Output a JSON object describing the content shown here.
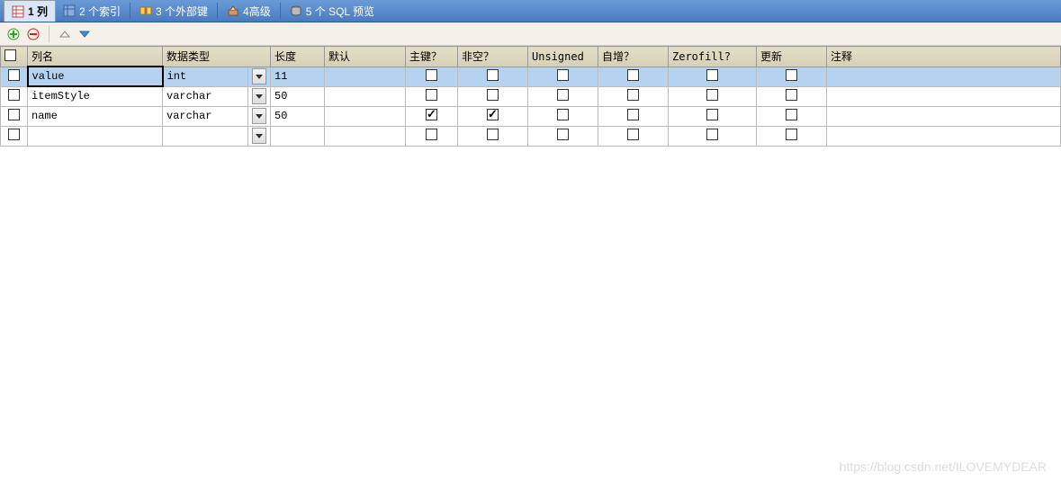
{
  "tabs": [
    {
      "label": "1 列",
      "active": true
    },
    {
      "label": "2 个索引",
      "active": false
    },
    {
      "label": "3 个外部键",
      "active": false
    },
    {
      "label": "4高级",
      "active": false
    },
    {
      "label": "5 个 SQL 预览",
      "active": false
    }
  ],
  "columns": {
    "name": "列名",
    "type": "数据类型",
    "len": "长度",
    "def": "默认",
    "pk": "主键？",
    "nn": "非空？",
    "uns": "Unsigned",
    "ai": "自增？",
    "zf": "Zerofill?",
    "upd": "更新",
    "com": "注释"
  },
  "rows": [
    {
      "name": "value",
      "type": "int",
      "len": "11",
      "pk": false,
      "nn": false,
      "uns": false,
      "ai": false,
      "zf": false,
      "upd": false,
      "selected": true
    },
    {
      "name": "itemStyle",
      "type": "varchar",
      "len": "50",
      "pk": false,
      "nn": false,
      "uns": false,
      "ai": false,
      "zf": false,
      "upd": false,
      "selected": false
    },
    {
      "name": "name",
      "type": "varchar",
      "len": "50",
      "pk": true,
      "nn": true,
      "uns": false,
      "ai": false,
      "zf": false,
      "upd": false,
      "selected": false
    },
    {
      "name": "",
      "type": "",
      "len": "",
      "pk": false,
      "nn": false,
      "uns": false,
      "ai": false,
      "zf": false,
      "upd": false,
      "selected": false,
      "empty": true
    }
  ],
  "watermark": "https://blog.csdn.net/ILOVEMYDEAR"
}
